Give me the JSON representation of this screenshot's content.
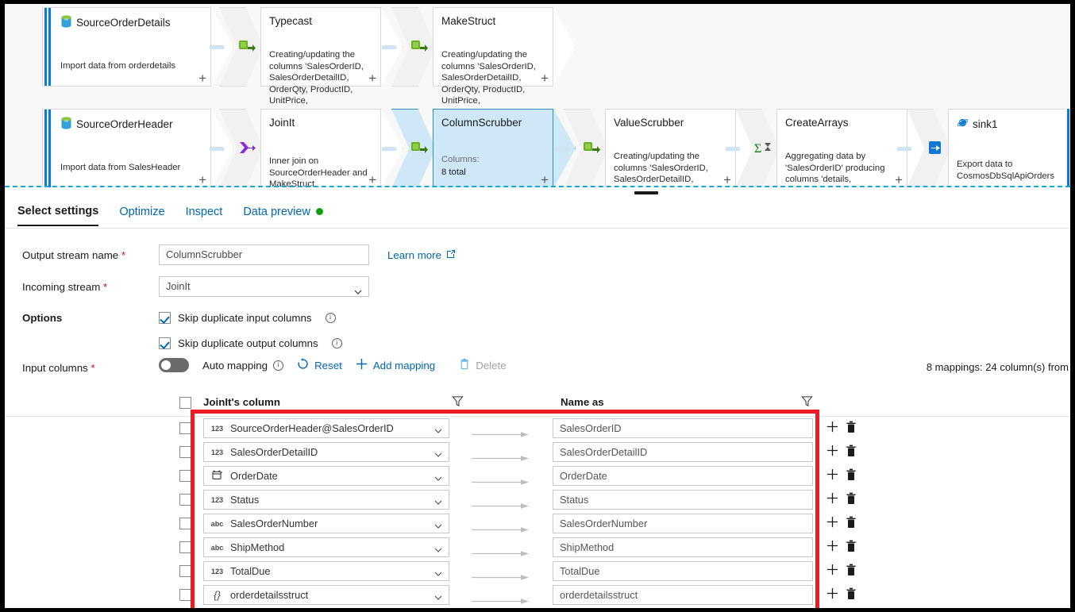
{
  "canvas": {
    "nodes_row1": [
      {
        "id": "SourceOrderDetails",
        "title": "SourceOrderDetails",
        "subtitle": "Import data from orderdetails",
        "icon": "sql-database-icon",
        "kind": "source",
        "plus": "+"
      },
      {
        "id": "Typecast",
        "title": "Typecast",
        "subtitle": "Creating/updating the columns 'SalesOrderID, SalesOrderDetailID, OrderQty, ProductID, UnitPrice,",
        "icon": "derived-column-icon",
        "kind": "transform",
        "plus": "+"
      },
      {
        "id": "MakeStruct",
        "title": "MakeStruct",
        "subtitle": "Creating/updating the columns 'SalesOrderID, SalesOrderDetailID, OrderQty, ProductID, UnitPrice,",
        "icon": "derived-column-icon",
        "kind": "transform",
        "plus": "+"
      }
    ],
    "nodes_row2": [
      {
        "id": "SourceOrderHeader",
        "title": "SourceOrderHeader",
        "subtitle": "Import data from SalesHeader",
        "icon": "sql-database-icon",
        "kind": "source",
        "plus": "+"
      },
      {
        "id": "JoinIt",
        "title": "JoinIt",
        "subtitle": "Inner join on SourceOrderHeader and MakeStruct",
        "icon": "join-icon",
        "kind": "transform",
        "plus": "+"
      },
      {
        "id": "ColumnScrubber",
        "title": "ColumnScrubber",
        "sublabel": "Columns:",
        "subtitle": "8 total",
        "icon": "select-icon",
        "kind": "transform",
        "selected": true,
        "plus": "+"
      },
      {
        "id": "ValueScrubber",
        "title": "ValueScrubber",
        "subtitle": "Creating/updating the columns 'SalesOrderID, SalesOrderDetailID, OrderDate, Status, SalesOrderNumber,",
        "icon": "derived-column-icon",
        "kind": "transform",
        "plus": "+"
      },
      {
        "id": "CreateArrays",
        "title": "CreateArrays",
        "subtitle": "Aggregating data by 'SalesOrderID' producing columns 'details, SalesOrderDetailID, OrderDate,",
        "icon": "aggregate-icon",
        "kind": "transform",
        "plus": "+"
      },
      {
        "id": "sink1",
        "title": "sink1",
        "subtitle": "Export data to CosmosDbSqlApiOrders",
        "icon": "cosmosdb-icon",
        "kind": "sink",
        "plus": ""
      }
    ]
  },
  "tabs": [
    {
      "label": "Select settings",
      "active": true
    },
    {
      "label": "Optimize",
      "active": false
    },
    {
      "label": "Inspect",
      "active": false
    },
    {
      "label": "Data preview",
      "active": false,
      "badge": "green-dot"
    }
  ],
  "form": {
    "output_stream_label": "Output stream name",
    "output_stream_value": "ColumnScrubber",
    "incoming_stream_label": "Incoming stream",
    "incoming_stream_value": "JoinIt",
    "learn_more": "Learn more",
    "options_label": "Options",
    "option_skip_input": "Skip duplicate input columns",
    "option_skip_output": "Skip duplicate output columns",
    "input_columns_label": "Input columns",
    "required_mark": "*"
  },
  "toolbar": {
    "auto_mapping": "Auto mapping",
    "auto_mapping_on": false,
    "reset": "Reset",
    "add_mapping": "Add mapping",
    "delete": "Delete",
    "mapping_count": "8 mappings: 24 column(s) from"
  },
  "table": {
    "header_source": "JoinIt's column",
    "header_target": "Name as",
    "rows": [
      {
        "type": "123",
        "source": "SourceOrderHeader@SalesOrderID",
        "target": "SalesOrderID"
      },
      {
        "type": "123",
        "source": "SalesOrderDetailID",
        "target": "SalesOrderDetailID"
      },
      {
        "type": "date",
        "source": "OrderDate",
        "target": "OrderDate"
      },
      {
        "type": "123",
        "source": "Status",
        "target": "Status"
      },
      {
        "type": "abc",
        "source": "SalesOrderNumber",
        "target": "SalesOrderNumber"
      },
      {
        "type": "abc",
        "source": "ShipMethod",
        "target": "ShipMethod"
      },
      {
        "type": "123",
        "source": "TotalDue",
        "target": "TotalDue"
      },
      {
        "type": "{}",
        "source": "orderdetailsstruct",
        "target": "orderdetailsstruct"
      }
    ]
  },
  "colors": {
    "accent": "#0066b4",
    "selected_node": "#cfe8f7",
    "annotation": "#ed1c24",
    "required": "#c50f1f",
    "preview_dot": "#0f9d0f"
  }
}
